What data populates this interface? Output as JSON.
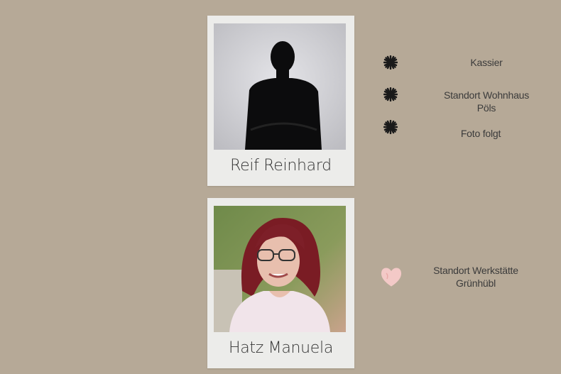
{
  "cards": [
    {
      "name": "Reif Reinhard",
      "photo": "silhouette-placeholder"
    },
    {
      "name": "Hatz Manuela",
      "photo": "portrait-photo"
    }
  ],
  "person1": {
    "details": [
      {
        "icon": "asterisk-flower-icon",
        "text": "Kassier"
      },
      {
        "icon": "asterisk-flower-icon",
        "line1": "Standort Wohnhaus",
        "line2": "Pöls"
      },
      {
        "icon": "asterisk-flower-icon",
        "text": "Foto folgt"
      }
    ]
  },
  "person2": {
    "details": [
      {
        "icon": "heart-icon",
        "line1": "Standort Werkstätte",
        "line2": "Grünhübl"
      }
    ]
  },
  "colors": {
    "background": "#b6a997",
    "card": "#ececea",
    "heart": "#f3c9c7",
    "asterisk": "#1a1a1a"
  }
}
